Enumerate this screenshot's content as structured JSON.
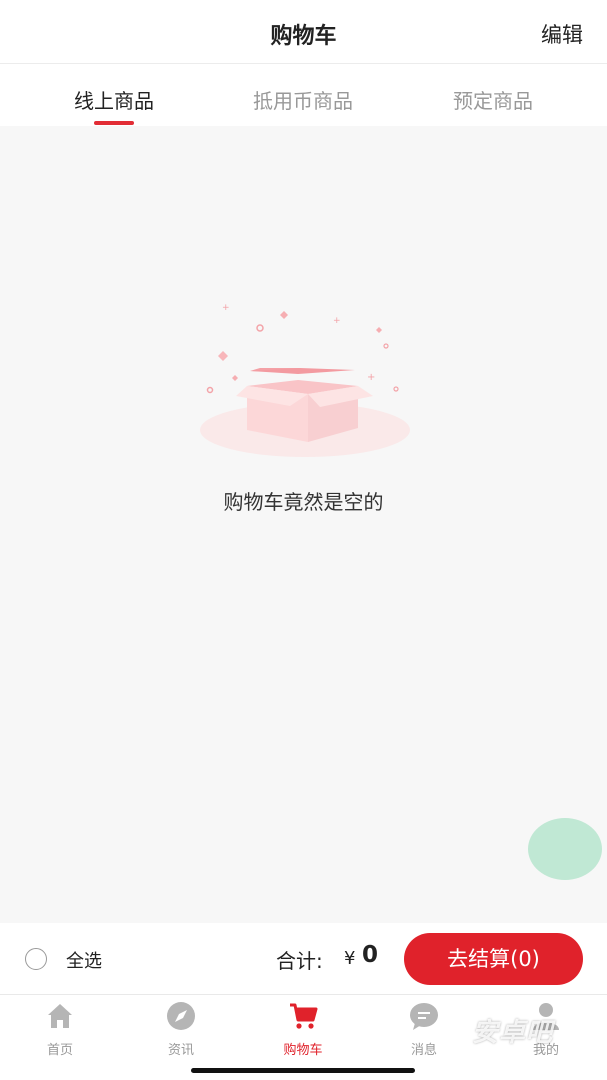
{
  "header": {
    "title": "购物车",
    "edit_label": "编辑"
  },
  "tabs": [
    {
      "label": "线上商品",
      "active": true
    },
    {
      "label": "抵用币商品",
      "active": false
    },
    {
      "label": "预定商品",
      "active": false
    }
  ],
  "empty_state": {
    "message": "购物车竟然是空的"
  },
  "checkout": {
    "select_all_label": "全选",
    "total_label": "合计:",
    "currency": "¥",
    "total_value": "0",
    "button_label": "去结算(0)"
  },
  "tabbar": {
    "items": [
      {
        "label": "首页",
        "icon": "home-icon",
        "active": false
      },
      {
        "label": "资讯",
        "icon": "compass-icon",
        "active": false
      },
      {
        "label": "购物车",
        "icon": "cart-icon",
        "active": true
      },
      {
        "label": "消息",
        "icon": "message-icon",
        "active": false
      },
      {
        "label": "我的",
        "icon": "user-icon",
        "active": false
      }
    ]
  },
  "watermark": "安卓吧",
  "colors": {
    "accent": "#e0222b",
    "inactive": "#999999",
    "bubble": "#b9e6cf"
  }
}
